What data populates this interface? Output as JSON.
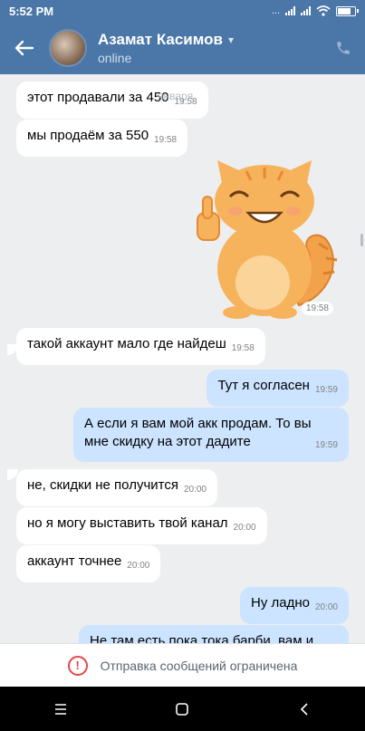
{
  "status_bar": {
    "time": "5:52 PM",
    "network": "..."
  },
  "header": {
    "contact_name": "Азамат Касимов",
    "status": "online",
    "back_icon": "arrow-left-icon",
    "call_icon": "phone-icon"
  },
  "messages": [
    {
      "dir": "in",
      "text": "этот продавали за 450",
      "time": "19:58",
      "overlay": "января"
    },
    {
      "dir": "in",
      "text": "мы продаём за 550",
      "time": "19:58"
    },
    {
      "dir": "in",
      "type": "sticker",
      "sticker": "cat-thumbs-up-sticker",
      "time": "19:58"
    },
    {
      "dir": "in",
      "text": "такой аккаунт мало где найдеш",
      "time": "19:58"
    },
    {
      "dir": "out",
      "text": "Тут я согласен",
      "time": "19:59"
    },
    {
      "dir": "out",
      "text": "А если я вам мой акк продам. То вы мне скидку на этот дадите",
      "time": "19:59"
    },
    {
      "dir": "in",
      "text": "не, скидки не получится",
      "time": "20:00"
    },
    {
      "dir": "in",
      "text": "но я могу выставить твой канал",
      "time": "20:00"
    },
    {
      "dir": "in",
      "text": "аккаунт точнее",
      "time": "20:00"
    },
    {
      "dir": "out",
      "text": "Ну ладно",
      "time": "20:00"
    },
    {
      "dir": "out",
      "text": "Не там есть пока тока барби, вам и"
    }
  ],
  "restriction": {
    "text": "Отправка сообщений ограничена",
    "icon": "exclamation-circle-icon"
  },
  "nav": {
    "menu_icon": "menu-icon",
    "home_icon": "square-home-icon",
    "back_icon": "triangle-back-icon"
  },
  "colors": {
    "header": "#4a76a8",
    "incoming_bubble": "#ffffff",
    "outgoing_bubble": "#cce4ff",
    "background": "#edeef0",
    "warning": "#e64646"
  }
}
